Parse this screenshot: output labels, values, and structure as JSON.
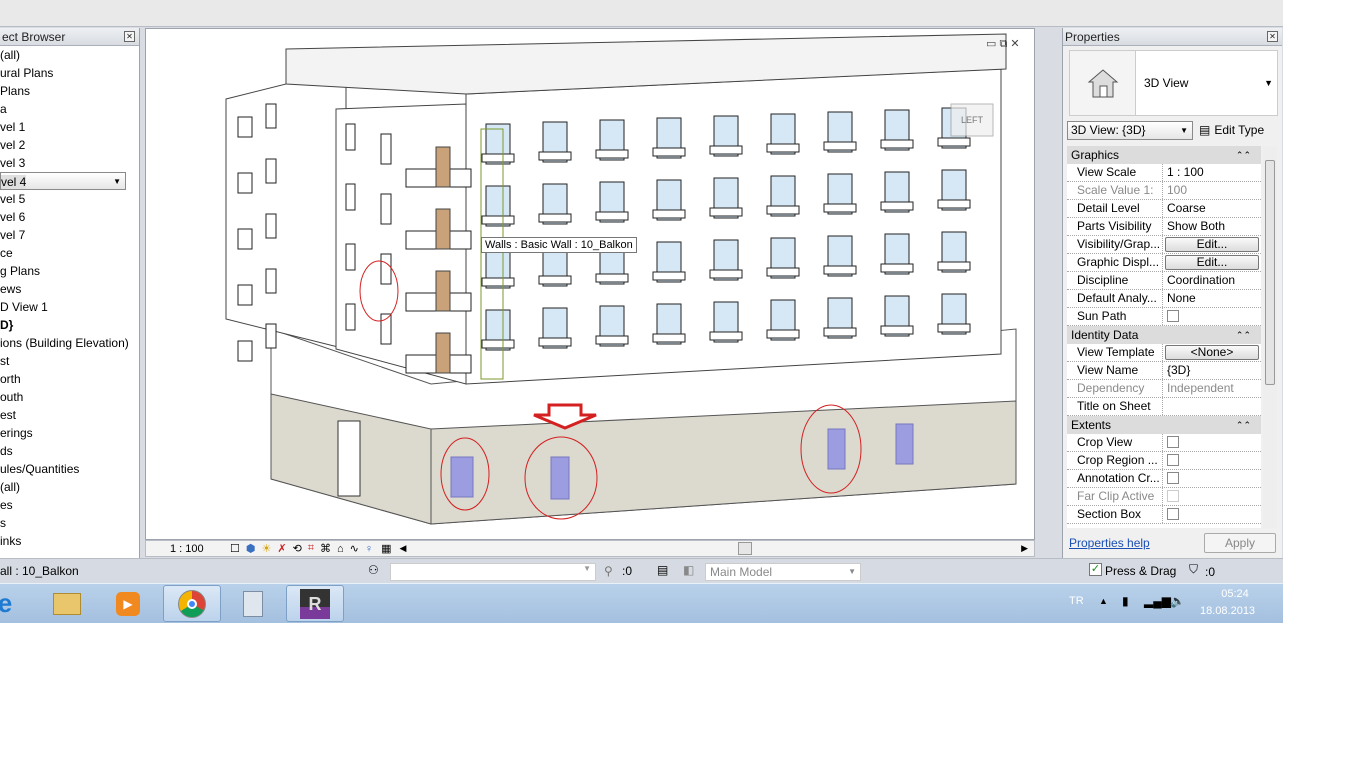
{
  "browser": {
    "title": "ect Browser",
    "items": [
      "(all)",
      "ural Plans",
      "Plans",
      "a",
      "vel 1",
      "vel 2",
      "vel 3",
      "vel 4",
      "vel 5",
      "vel 6",
      "vel 7",
      "ce",
      "g Plans",
      "ews",
      "D View 1",
      "D}",
      "ions (Building Elevation)",
      "st",
      "orth",
      "outh",
      "est",
      "erings",
      "ds",
      "ules/Quantities",
      "(all)",
      "es",
      "s",
      "inks"
    ],
    "selected_index": 7,
    "bold_index": 15
  },
  "viewport": {
    "tooltip": "Walls : Basic Wall : 10_Balkon",
    "viewcube_label": "LEFT"
  },
  "viewbar": {
    "scale": "1 : 100"
  },
  "properties": {
    "title": "Properties",
    "type_name": "3D View",
    "selector": "3D View: {3D}",
    "edit_type": "Edit Type",
    "groups": [
      {
        "name": "Graphics",
        "rows": [
          {
            "k": "View Scale",
            "v": "1 : 100"
          },
          {
            "k": "Scale Value    1:",
            "v": "100",
            "disabled": true
          },
          {
            "k": "Detail Level",
            "v": "Coarse"
          },
          {
            "k": "Parts Visibility",
            "v": "Show Both"
          },
          {
            "k": "Visibility/Grap...",
            "v": "Edit...",
            "button": true
          },
          {
            "k": "Graphic Displ...",
            "v": "Edit...",
            "button": true
          },
          {
            "k": "Discipline",
            "v": "Coordination"
          },
          {
            "k": "Default Analy...",
            "v": "None"
          },
          {
            "k": "Sun Path",
            "checkbox": false
          }
        ]
      },
      {
        "name": "Identity Data",
        "rows": [
          {
            "k": "View Template",
            "v": "<None>",
            "button": true
          },
          {
            "k": "View Name",
            "v": "{3D}"
          },
          {
            "k": "Dependency",
            "v": "Independent",
            "disabled": true
          },
          {
            "k": "Title on Sheet",
            "v": ""
          }
        ]
      },
      {
        "name": "Extents",
        "rows": [
          {
            "k": "Crop View",
            "checkbox": false
          },
          {
            "k": "Crop Region ...",
            "checkbox": false
          },
          {
            "k": "Annotation Cr...",
            "checkbox": false
          },
          {
            "k": "Far Clip Active",
            "checkbox": false,
            "disabled": true
          },
          {
            "k": "Section Box",
            "checkbox": false
          }
        ]
      }
    ],
    "help": "Properties help",
    "apply": "Apply"
  },
  "status": {
    "text": "all : 10_Balkon",
    "selection_count": ":0",
    "workset": "Main Model",
    "press_drag": "Press & Drag",
    "filter_count": ":0"
  },
  "taskbar": {
    "lang": "TR",
    "time": "05:24",
    "date": "18.08.2013"
  },
  "colors": {
    "accent_red": "#d42020",
    "link": "#1a4fb5"
  }
}
